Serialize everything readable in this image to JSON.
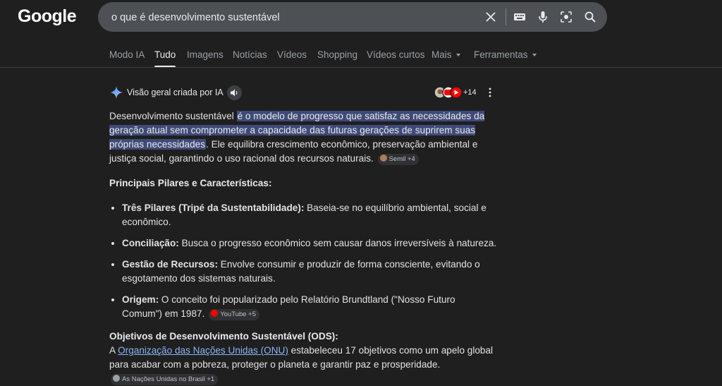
{
  "logo": "Google",
  "search": {
    "query": "o que é desenvolvimento sustentável"
  },
  "tabs": [
    "Modo IA",
    "Tudo",
    "Imagens",
    "Notícias",
    "Vídeos",
    "Shopping",
    "Vídeos curtos",
    "Mais",
    "Ferramentas"
  ],
  "active_tab": "Tudo",
  "ai": {
    "title": "Visão geral criada por IA",
    "sources_count": "+14",
    "intro": {
      "pre": "Desenvolvimento sustentável ",
      "highlight": "é o modelo de progresso que satisfaz as necessidades da geração atual sem comprometer a capacidade das futuras gerações de suprirem suas próprias necessidades",
      "post": ". Ele equilibra crescimento econômico, preservação ambiental e justiça social, garantindo o uso racional dos recursos naturais.",
      "chip": "Semil +4"
    },
    "pillars_heading": "Principais Pilares e Características:",
    "bullets": [
      {
        "bold": "Três Pilares (Tripé da Sustentabilidade):",
        "text": " Baseia-se no equilíbrio ambiental, social e econômico."
      },
      {
        "bold": "Conciliação:",
        "text": " Busca o progresso econômico sem causar danos irreversíveis à natureza."
      },
      {
        "bold": "Gestão de Recursos:",
        "text": " Envolve consumir e produzir de forma consciente, evitando o esgotamento dos sistemas naturais."
      },
      {
        "bold": "Origem:",
        "text": " O conceito foi popularizado pelo Relatório Brundtland (\"Nosso Futuro Comum\") em 1987.",
        "chip": "YouTube +5"
      }
    ],
    "ods": {
      "heading": "Objetivos de Desenvolvimento Sustentável (ODS):",
      "pre": "A ",
      "link": "Organização das Nações Unidas (ONU)",
      "post": " estabeleceu 17 objetivos como um apelo global para acabar com a pobreza, proteger o planeta e garantir paz e prosperidade.",
      "chip": "As Nações Unidas no Brasil +1"
    }
  },
  "colors": {
    "background": "#1f1f1f",
    "search_bg": "#4d5156",
    "highlight": "#3f4a78",
    "link": "#8ab4f8"
  }
}
